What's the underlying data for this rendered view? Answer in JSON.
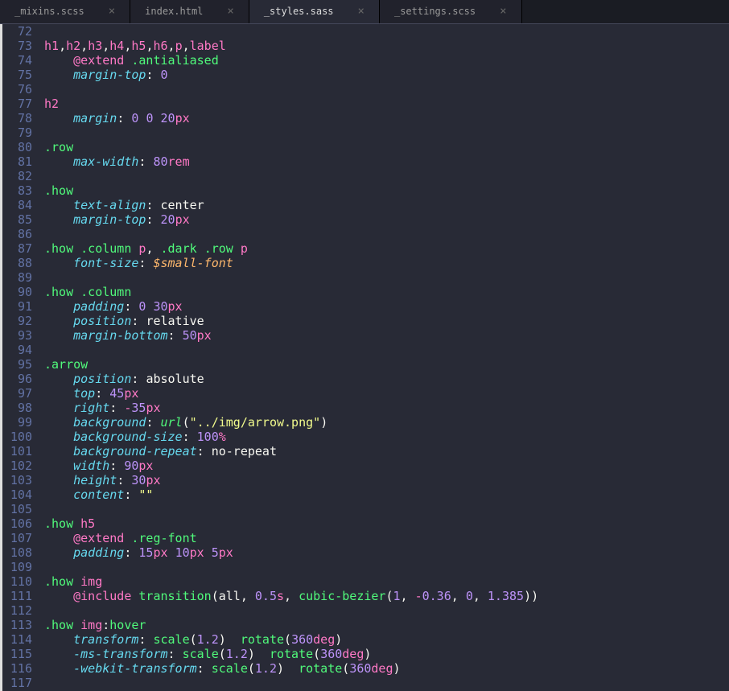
{
  "tabs": [
    {
      "label": "_mixins.scss",
      "active": false
    },
    {
      "label": "index.html",
      "active": false
    },
    {
      "label": "_styles.sass",
      "active": true
    },
    {
      "label": "_settings.scss",
      "active": false
    }
  ],
  "close_glyph": "×",
  "gutter": {
    "start": 72,
    "end": 117
  },
  "code_lines": [
    {
      "n": 72,
      "tokens": []
    },
    {
      "n": 73,
      "tokens": [
        {
          "c": "c-tag",
          "t": "h1"
        },
        {
          "c": "c-punct",
          "t": ","
        },
        {
          "c": "c-tag",
          "t": "h2"
        },
        {
          "c": "c-punct",
          "t": ","
        },
        {
          "c": "c-tag",
          "t": "h3"
        },
        {
          "c": "c-punct",
          "t": ","
        },
        {
          "c": "c-tag",
          "t": "h4"
        },
        {
          "c": "c-punct",
          "t": ","
        },
        {
          "c": "c-tag",
          "t": "h5"
        },
        {
          "c": "c-punct",
          "t": ","
        },
        {
          "c": "c-tag",
          "t": "h6"
        },
        {
          "c": "c-punct",
          "t": ","
        },
        {
          "c": "c-tag",
          "t": "p"
        },
        {
          "c": "c-punct",
          "t": ","
        },
        {
          "c": "c-tag",
          "t": "label"
        }
      ]
    },
    {
      "n": 74,
      "indent": 4,
      "tokens": [
        {
          "c": "c-atkw",
          "t": "@extend "
        },
        {
          "c": "c-extname",
          "t": ".antialiased"
        }
      ]
    },
    {
      "n": 75,
      "indent": 4,
      "tokens": [
        {
          "c": "c-prop",
          "t": "margin-top"
        },
        {
          "c": "c-punct",
          "t": ": "
        },
        {
          "c": "c-num",
          "t": "0"
        }
      ]
    },
    {
      "n": 76,
      "tokens": []
    },
    {
      "n": 77,
      "tokens": [
        {
          "c": "c-tag",
          "t": "h2"
        }
      ]
    },
    {
      "n": 78,
      "indent": 4,
      "tokens": [
        {
          "c": "c-prop",
          "t": "margin"
        },
        {
          "c": "c-punct",
          "t": ": "
        },
        {
          "c": "c-num",
          "t": "0"
        },
        {
          "c": "c-punct",
          "t": " "
        },
        {
          "c": "c-num",
          "t": "0"
        },
        {
          "c": "c-punct",
          "t": " "
        },
        {
          "c": "c-num",
          "t": "20"
        },
        {
          "c": "c-unit",
          "t": "px"
        }
      ]
    },
    {
      "n": 79,
      "tokens": []
    },
    {
      "n": 80,
      "tokens": [
        {
          "c": "c-selclass",
          "t": ".row"
        }
      ]
    },
    {
      "n": 81,
      "indent": 4,
      "tokens": [
        {
          "c": "c-prop",
          "t": "max-width"
        },
        {
          "c": "c-punct",
          "t": ": "
        },
        {
          "c": "c-num",
          "t": "80"
        },
        {
          "c": "c-unit",
          "t": "rem"
        }
      ]
    },
    {
      "n": 82,
      "tokens": []
    },
    {
      "n": 83,
      "tokens": [
        {
          "c": "c-selclass",
          "t": ".how"
        }
      ]
    },
    {
      "n": 84,
      "indent": 4,
      "tokens": [
        {
          "c": "c-prop",
          "t": "text-align"
        },
        {
          "c": "c-punct",
          "t": ": "
        },
        {
          "c": "c-val",
          "t": "center"
        }
      ]
    },
    {
      "n": 85,
      "indent": 4,
      "tokens": [
        {
          "c": "c-prop",
          "t": "margin-top"
        },
        {
          "c": "c-punct",
          "t": ": "
        },
        {
          "c": "c-num",
          "t": "20"
        },
        {
          "c": "c-unit",
          "t": "px"
        }
      ]
    },
    {
      "n": 86,
      "tokens": []
    },
    {
      "n": 87,
      "tokens": [
        {
          "c": "c-selclass",
          "t": ".how"
        },
        {
          "c": "c-punct",
          "t": " "
        },
        {
          "c": "c-selclass",
          "t": ".column"
        },
        {
          "c": "c-punct",
          "t": " "
        },
        {
          "c": "c-tag",
          "t": "p"
        },
        {
          "c": "c-punct",
          "t": ", "
        },
        {
          "c": "c-selclass",
          "t": ".dark"
        },
        {
          "c": "c-punct",
          "t": " "
        },
        {
          "c": "c-selclass",
          "t": ".row"
        },
        {
          "c": "c-punct",
          "t": " "
        },
        {
          "c": "c-tag",
          "t": "p"
        }
      ]
    },
    {
      "n": 88,
      "indent": 4,
      "tokens": [
        {
          "c": "c-prop",
          "t": "font-size"
        },
        {
          "c": "c-punct",
          "t": ": "
        },
        {
          "c": "c-var",
          "t": "$small-font"
        }
      ]
    },
    {
      "n": 89,
      "tokens": []
    },
    {
      "n": 90,
      "tokens": [
        {
          "c": "c-selclass",
          "t": ".how"
        },
        {
          "c": "c-punct",
          "t": " "
        },
        {
          "c": "c-selclass",
          "t": ".column"
        }
      ]
    },
    {
      "n": 91,
      "indent": 4,
      "tokens": [
        {
          "c": "c-prop",
          "t": "padding"
        },
        {
          "c": "c-punct",
          "t": ": "
        },
        {
          "c": "c-num",
          "t": "0"
        },
        {
          "c": "c-punct",
          "t": " "
        },
        {
          "c": "c-num",
          "t": "30"
        },
        {
          "c": "c-unit",
          "t": "px"
        }
      ]
    },
    {
      "n": 92,
      "indent": 4,
      "tokens": [
        {
          "c": "c-prop",
          "t": "position"
        },
        {
          "c": "c-punct",
          "t": ": "
        },
        {
          "c": "c-val",
          "t": "relative"
        }
      ]
    },
    {
      "n": 93,
      "indent": 4,
      "tokens": [
        {
          "c": "c-prop",
          "t": "margin-bottom"
        },
        {
          "c": "c-punct",
          "t": ": "
        },
        {
          "c": "c-num",
          "t": "50"
        },
        {
          "c": "c-unit",
          "t": "px"
        }
      ]
    },
    {
      "n": 94,
      "tokens": []
    },
    {
      "n": 95,
      "tokens": [
        {
          "c": "c-selclass",
          "t": ".arrow"
        }
      ]
    },
    {
      "n": 96,
      "indent": 4,
      "tokens": [
        {
          "c": "c-prop",
          "t": "position"
        },
        {
          "c": "c-punct",
          "t": ": "
        },
        {
          "c": "c-val",
          "t": "absolute"
        }
      ]
    },
    {
      "n": 97,
      "indent": 4,
      "tokens": [
        {
          "c": "c-prop",
          "t": "top"
        },
        {
          "c": "c-punct",
          "t": ": "
        },
        {
          "c": "c-num",
          "t": "45"
        },
        {
          "c": "c-unit",
          "t": "px"
        }
      ]
    },
    {
      "n": 98,
      "indent": 4,
      "tokens": [
        {
          "c": "c-prop",
          "t": "right"
        },
        {
          "c": "c-punct",
          "t": ": "
        },
        {
          "c": "c-unit",
          "t": "-"
        },
        {
          "c": "c-num",
          "t": "35"
        },
        {
          "c": "c-unit",
          "t": "px"
        }
      ]
    },
    {
      "n": 99,
      "indent": 4,
      "tokens": [
        {
          "c": "c-prop",
          "t": "background"
        },
        {
          "c": "c-punct",
          "t": ": "
        },
        {
          "c": "c-func i",
          "t": "url"
        },
        {
          "c": "c-brace",
          "t": "("
        },
        {
          "c": "c-str",
          "t": "\"../img/arrow.png\""
        },
        {
          "c": "c-brace",
          "t": ")"
        }
      ]
    },
    {
      "n": 100,
      "indent": 4,
      "tokens": [
        {
          "c": "c-prop",
          "t": "background-size"
        },
        {
          "c": "c-punct",
          "t": ": "
        },
        {
          "c": "c-num",
          "t": "100"
        },
        {
          "c": "c-unit",
          "t": "%"
        }
      ]
    },
    {
      "n": 101,
      "indent": 4,
      "tokens": [
        {
          "c": "c-prop",
          "t": "background-repeat"
        },
        {
          "c": "c-punct",
          "t": ": "
        },
        {
          "c": "c-val",
          "t": "no-repeat"
        }
      ]
    },
    {
      "n": 102,
      "indent": 4,
      "tokens": [
        {
          "c": "c-prop",
          "t": "width"
        },
        {
          "c": "c-punct",
          "t": ": "
        },
        {
          "c": "c-num",
          "t": "90"
        },
        {
          "c": "c-unit",
          "t": "px"
        }
      ]
    },
    {
      "n": 103,
      "indent": 4,
      "tokens": [
        {
          "c": "c-prop",
          "t": "height"
        },
        {
          "c": "c-punct",
          "t": ": "
        },
        {
          "c": "c-num",
          "t": "30"
        },
        {
          "c": "c-unit",
          "t": "px"
        }
      ]
    },
    {
      "n": 104,
      "indent": 4,
      "tokens": [
        {
          "c": "c-prop",
          "t": "content"
        },
        {
          "c": "c-punct",
          "t": ": "
        },
        {
          "c": "c-str",
          "t": "\"\""
        }
      ]
    },
    {
      "n": 105,
      "tokens": []
    },
    {
      "n": 106,
      "tokens": [
        {
          "c": "c-selclass",
          "t": ".how"
        },
        {
          "c": "c-punct",
          "t": " "
        },
        {
          "c": "c-tag",
          "t": "h5"
        }
      ]
    },
    {
      "n": 107,
      "indent": 4,
      "tokens": [
        {
          "c": "c-atkw",
          "t": "@extend "
        },
        {
          "c": "c-extname",
          "t": ".reg-font"
        }
      ]
    },
    {
      "n": 108,
      "indent": 4,
      "tokens": [
        {
          "c": "c-prop",
          "t": "padding"
        },
        {
          "c": "c-punct",
          "t": ": "
        },
        {
          "c": "c-num",
          "t": "15"
        },
        {
          "c": "c-unit",
          "t": "px"
        },
        {
          "c": "c-punct",
          "t": " "
        },
        {
          "c": "c-num",
          "t": "10"
        },
        {
          "c": "c-unit",
          "t": "px"
        },
        {
          "c": "c-punct",
          "t": " "
        },
        {
          "c": "c-num",
          "t": "5"
        },
        {
          "c": "c-unit",
          "t": "px"
        }
      ]
    },
    {
      "n": 109,
      "tokens": []
    },
    {
      "n": 110,
      "tokens": [
        {
          "c": "c-selclass",
          "t": ".how"
        },
        {
          "c": "c-punct",
          "t": " "
        },
        {
          "c": "c-tag",
          "t": "img"
        }
      ]
    },
    {
      "n": 111,
      "indent": 4,
      "tokens": [
        {
          "c": "c-atkw",
          "t": "@include "
        },
        {
          "c": "c-func",
          "t": "transition"
        },
        {
          "c": "c-brace",
          "t": "("
        },
        {
          "c": "c-val",
          "t": "all, "
        },
        {
          "c": "c-num",
          "t": "0.5"
        },
        {
          "c": "c-unit",
          "t": "s"
        },
        {
          "c": "c-val",
          "t": ", "
        },
        {
          "c": "c-func",
          "t": "cubic-bezier"
        },
        {
          "c": "c-brace",
          "t": "("
        },
        {
          "c": "c-num",
          "t": "1"
        },
        {
          "c": "c-val",
          "t": ", "
        },
        {
          "c": "c-unit",
          "t": "-"
        },
        {
          "c": "c-num",
          "t": "0.36"
        },
        {
          "c": "c-val",
          "t": ", "
        },
        {
          "c": "c-num",
          "t": "0"
        },
        {
          "c": "c-val",
          "t": ", "
        },
        {
          "c": "c-num",
          "t": "1.385"
        },
        {
          "c": "c-brace",
          "t": "))"
        }
      ]
    },
    {
      "n": 112,
      "tokens": []
    },
    {
      "n": 113,
      "tokens": [
        {
          "c": "c-selclass",
          "t": ".how"
        },
        {
          "c": "c-punct",
          "t": " "
        },
        {
          "c": "c-tag",
          "t": "img"
        },
        {
          "c": "c-punct",
          "t": ":"
        },
        {
          "c": "c-func",
          "t": "hover"
        }
      ]
    },
    {
      "n": 114,
      "indent": 4,
      "tokens": [
        {
          "c": "c-prop",
          "t": "transform"
        },
        {
          "c": "c-punct",
          "t": ": "
        },
        {
          "c": "c-func",
          "t": "scale"
        },
        {
          "c": "c-brace",
          "t": "("
        },
        {
          "c": "c-num",
          "t": "1.2"
        },
        {
          "c": "c-brace",
          "t": ")"
        },
        {
          "c": "c-punct",
          "t": "  "
        },
        {
          "c": "c-func",
          "t": "rotate"
        },
        {
          "c": "c-brace",
          "t": "("
        },
        {
          "c": "c-num",
          "t": "360"
        },
        {
          "c": "c-unit",
          "t": "deg"
        },
        {
          "c": "c-brace",
          "t": ")"
        }
      ]
    },
    {
      "n": 115,
      "indent": 4,
      "tokens": [
        {
          "c": "c-prop",
          "t": "-ms-transform"
        },
        {
          "c": "c-punct",
          "t": ": "
        },
        {
          "c": "c-func",
          "t": "scale"
        },
        {
          "c": "c-brace",
          "t": "("
        },
        {
          "c": "c-num",
          "t": "1.2"
        },
        {
          "c": "c-brace",
          "t": ")"
        },
        {
          "c": "c-punct",
          "t": "  "
        },
        {
          "c": "c-func",
          "t": "rotate"
        },
        {
          "c": "c-brace",
          "t": "("
        },
        {
          "c": "c-num",
          "t": "360"
        },
        {
          "c": "c-unit",
          "t": "deg"
        },
        {
          "c": "c-brace",
          "t": ")"
        }
      ]
    },
    {
      "n": 116,
      "indent": 4,
      "tokens": [
        {
          "c": "c-prop",
          "t": "-webkit-transform"
        },
        {
          "c": "c-punct",
          "t": ": "
        },
        {
          "c": "c-func",
          "t": "scale"
        },
        {
          "c": "c-brace",
          "t": "("
        },
        {
          "c": "c-num",
          "t": "1.2"
        },
        {
          "c": "c-brace",
          "t": ")"
        },
        {
          "c": "c-punct",
          "t": "  "
        },
        {
          "c": "c-func",
          "t": "rotate"
        },
        {
          "c": "c-brace",
          "t": "("
        },
        {
          "c": "c-num",
          "t": "360"
        },
        {
          "c": "c-unit",
          "t": "deg"
        },
        {
          "c": "c-brace",
          "t": ")"
        }
      ]
    },
    {
      "n": 117,
      "tokens": []
    }
  ]
}
